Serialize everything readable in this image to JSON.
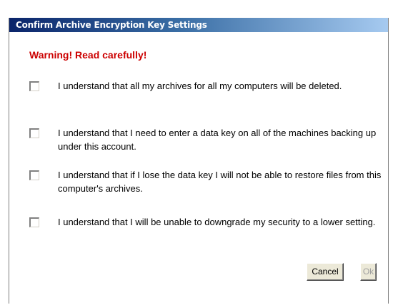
{
  "dialog": {
    "title": "Confirm Archive Encryption Key Settings",
    "warning": "Warning! Read carefully!",
    "items": [
      {
        "label": "I understand that all my archives for all my computers will be deleted.",
        "checked": false
      },
      {
        "label": "I understand that I need to enter a data key on all of the machines backing up under this account.",
        "checked": false
      },
      {
        "label": "I understand that if I lose the data key I will not be able to restore files from this computer's archives.",
        "checked": false
      },
      {
        "label": "I understand that I will be unable to downgrade my security to a lower setting.",
        "checked": false
      }
    ],
    "buttons": {
      "cancel_label": "Cancel",
      "ok_label": "Ok",
      "ok_enabled": false
    }
  },
  "colors": {
    "titlebar_start": "#0a246a",
    "titlebar_end": "#a6caf0",
    "warning": "#cc0000"
  }
}
